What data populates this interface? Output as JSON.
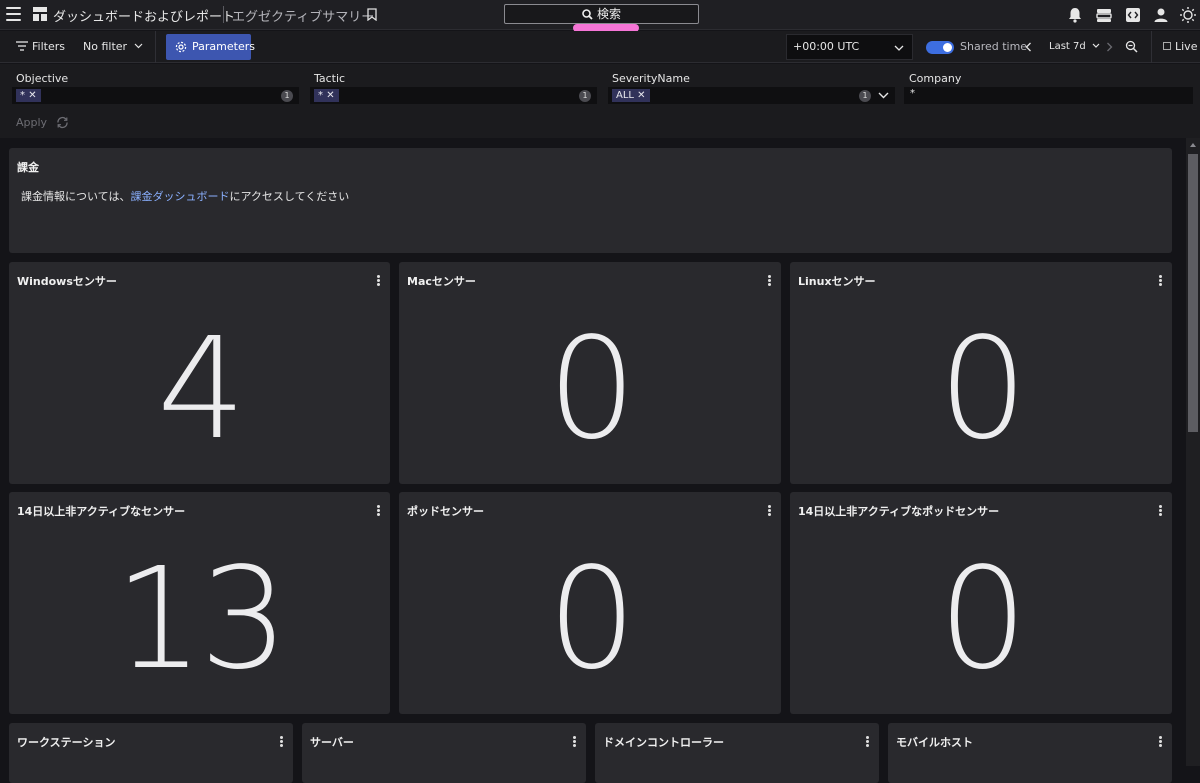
{
  "header": {
    "title": "ダッシュボードおよびレポート",
    "subtitle": "エグゼクティブサマリー",
    "search_label": "検索"
  },
  "toolbar": {
    "filters_label": "Filters",
    "no_filter_label": "No filter",
    "parameters_label": "Parameters",
    "timezone": "+00:00 UTC",
    "shared_time_label": "Shared time",
    "time_range": "Last 7d",
    "live_label": "Live"
  },
  "parameters": {
    "fields": [
      {
        "label": "Objective",
        "chip": "*",
        "count": "1"
      },
      {
        "label": "Tactic",
        "chip": "*",
        "count": "1"
      },
      {
        "label": "SeverityName",
        "chip": "ALL",
        "count": "1"
      },
      {
        "label": "Company",
        "value": "*"
      }
    ],
    "apply_label": "Apply"
  },
  "billing": {
    "title": "課金",
    "text_before": "課金情報については、",
    "link": "課金ダッシュボード",
    "text_after": "にアクセスしてください"
  },
  "widgets": [
    {
      "title": "Windowsセンサー",
      "value": "4"
    },
    {
      "title": "Macセンサー",
      "value": "0"
    },
    {
      "title": "Linuxセンサー",
      "value": "0"
    },
    {
      "title": "14日以上非アクティブなセンサー",
      "value": "13"
    },
    {
      "title": "ポッドセンサー",
      "value": "0"
    },
    {
      "title": "14日以上非アクティブなポッドセンサー",
      "value": "0"
    }
  ],
  "bottom_widgets": [
    {
      "title": "ワークステーション"
    },
    {
      "title": "サーバー"
    },
    {
      "title": "ドメインコントローラー"
    },
    {
      "title": "モバイルホスト"
    }
  ],
  "colors": {
    "accent": "#3d56b0",
    "toggle": "#3d6ee0",
    "link": "#8ab0ff",
    "highlight": "#f575d6"
  }
}
